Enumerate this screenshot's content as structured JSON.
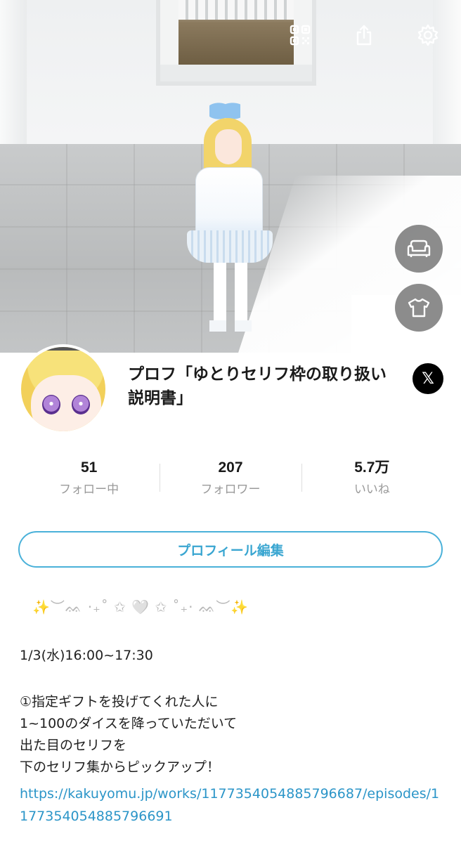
{
  "header": {
    "icons": [
      "qr-code-icon",
      "share-icon",
      "gear-icon"
    ],
    "side_buttons": [
      "sofa-icon",
      "tshirt-icon"
    ]
  },
  "profile": {
    "display_name": "プロフ「ゆとりセリフ枠の取り扱い説明書」",
    "social_button": "𝕏"
  },
  "stats": [
    {
      "value": "51",
      "label": "フォロー中"
    },
    {
      "value": "207",
      "label": "フォロワー"
    },
    {
      "value": "5.7万",
      "label": "いいね"
    }
  ],
  "edit_button": {
    "label": "プロフィール編集"
  },
  "bio": {
    "decoration": "✨︶ᨐ ‧₊˚ ✩ 🤍 ✩ ˚₊‧ ᨐ︶✨",
    "date_line": "1/3(水)16:00~17:30",
    "lines": [
      "①指定ギフトを投げてくれた人に",
      "1~100のダイスを降っていただいて",
      "出た目のセリフを",
      "下のセリフ集からピックアップ！"
    ],
    "link": "https://kakuyomu.jp/works/1177354054885796687/episodes/1177354054885796691"
  },
  "colors": {
    "accent": "#3aa6d1",
    "link": "#2b95c8",
    "label_gray": "#9a9a9a"
  }
}
